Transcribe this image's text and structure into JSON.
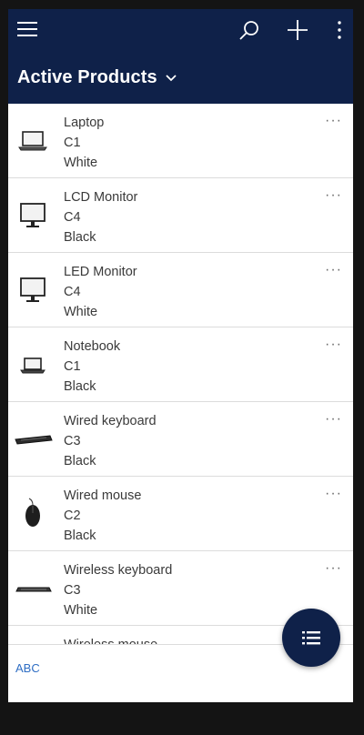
{
  "header": {
    "title": "Active Products",
    "bg_color": "#0f2149"
  },
  "products": [
    {
      "name": "Laptop",
      "code": "C1",
      "color": "White",
      "icon": "laptop-icon"
    },
    {
      "name": "LCD Monitor",
      "code": "C4",
      "color": "Black",
      "icon": "monitor-icon"
    },
    {
      "name": "LED Monitor",
      "code": "C4",
      "color": "White",
      "icon": "monitor-icon"
    },
    {
      "name": "Notebook",
      "code": "C1",
      "color": "Black",
      "icon": "laptop-icon"
    },
    {
      "name": "Wired keyboard",
      "code": "C3",
      "color": "Black",
      "icon": "keyboard-icon"
    },
    {
      "name": "Wired mouse",
      "code": "C2",
      "color": "Black",
      "icon": "mouse-icon"
    },
    {
      "name": "Wireless keyboard",
      "code": "C3",
      "color": "White",
      "icon": "keyboard-icon"
    },
    {
      "name": "Wireless mouse",
      "code": "",
      "color": "",
      "icon": ""
    }
  ],
  "row_more_label": "···",
  "footer": {
    "index_label": "ABC"
  },
  "fab": {
    "icon": "list-icon"
  }
}
